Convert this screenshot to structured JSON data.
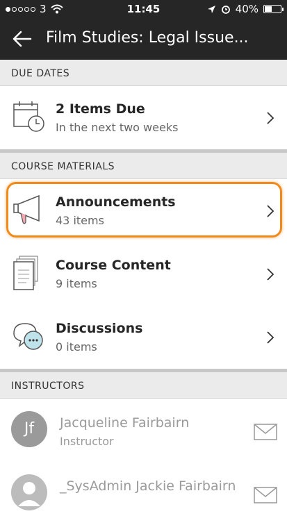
{
  "status_bar": {
    "carrier": "3",
    "time": "11:45",
    "battery": "40%",
    "battery_level": 0.4
  },
  "nav": {
    "title": "Film Studies: Legal Issue..."
  },
  "due_dates": {
    "header": "DUE DATES",
    "title": "2 Items Due",
    "subtitle": "In the next two weeks"
  },
  "course_materials": {
    "header": "COURSE MATERIALS",
    "items": [
      {
        "title": "Announcements",
        "count": "43 items"
      },
      {
        "title": "Course Content",
        "count": "9 items"
      },
      {
        "title": "Discussions",
        "count": "0 items"
      }
    ]
  },
  "instructors": {
    "header": "INSTRUCTORS",
    "items": [
      {
        "initials": "Jf",
        "name": "Jacqueline Fairbairn",
        "role": "Instructor"
      },
      {
        "name": "_SysAdmin Jackie Fairbairn"
      }
    ]
  },
  "colors": {
    "header_bg": "#262626",
    "highlight": "#f08a1c",
    "muted_text": "#9a9a9a"
  }
}
